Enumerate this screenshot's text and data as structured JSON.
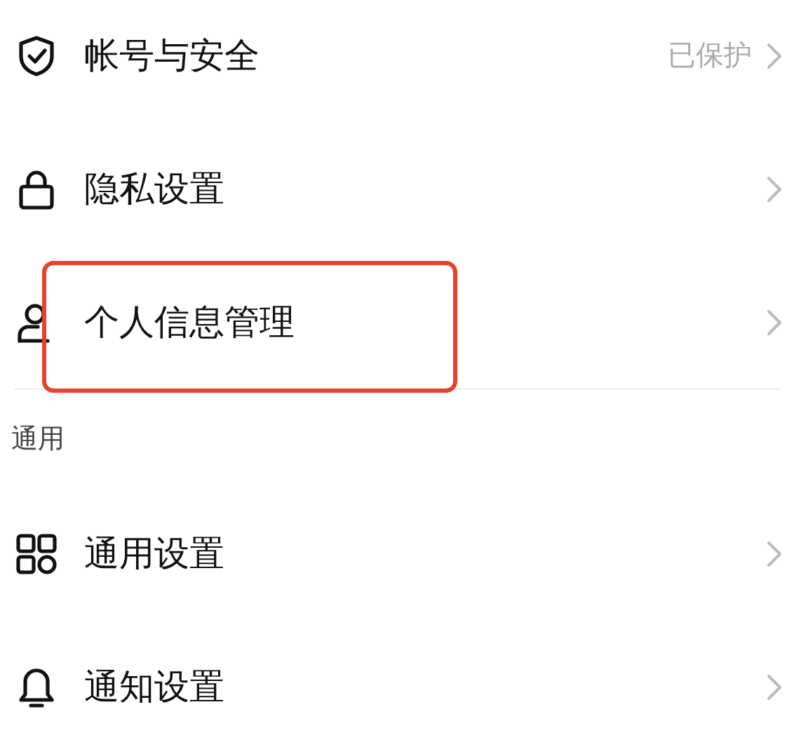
{
  "groups": [
    {
      "items": [
        {
          "label": "帐号与安全",
          "value": "已保护",
          "highlighted": false
        },
        {
          "label": "隐私设置",
          "highlighted": false
        },
        {
          "label": "个人信息管理",
          "highlighted": true
        }
      ]
    },
    {
      "header": "通用",
      "items": [
        {
          "label": "通用设置",
          "highlighted": false
        },
        {
          "label": "通知设置",
          "highlighted": false
        }
      ]
    }
  ]
}
